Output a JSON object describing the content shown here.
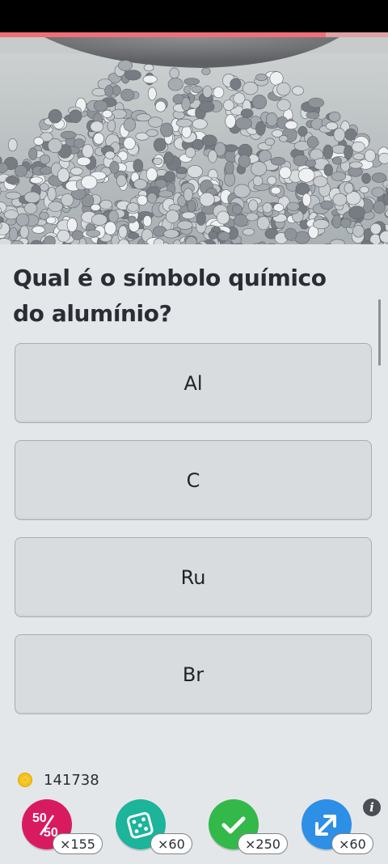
{
  "progress": {
    "fraction": 0.84,
    "color": "#f06f76"
  },
  "hero": {
    "image": "pile-of-aluminium-cans"
  },
  "question": {
    "text": "Qual é o símbolo químico do alumínio?"
  },
  "answers": [
    {
      "label": "Al"
    },
    {
      "label": "C"
    },
    {
      "label": "Ru"
    },
    {
      "label": "Br"
    }
  ],
  "coins": {
    "icon": "coin-icon",
    "value": "141738"
  },
  "powerups": [
    {
      "name": "fifty-fifty",
      "icon": "fifty-fifty-icon",
      "count": "×155",
      "color": "#d81b60",
      "glyph_top": "50",
      "glyph_bottom": "50"
    },
    {
      "name": "dice",
      "icon": "dice-icon",
      "count": "×60",
      "color": "#1cb49a"
    },
    {
      "name": "correct-answer",
      "icon": "check-icon",
      "count": "×250",
      "color": "#33b84a"
    },
    {
      "name": "skip",
      "icon": "swap-arrows-icon",
      "count": "×60",
      "color": "#2d8fe6"
    }
  ],
  "info": {
    "icon": "info-icon",
    "glyph": "i"
  }
}
